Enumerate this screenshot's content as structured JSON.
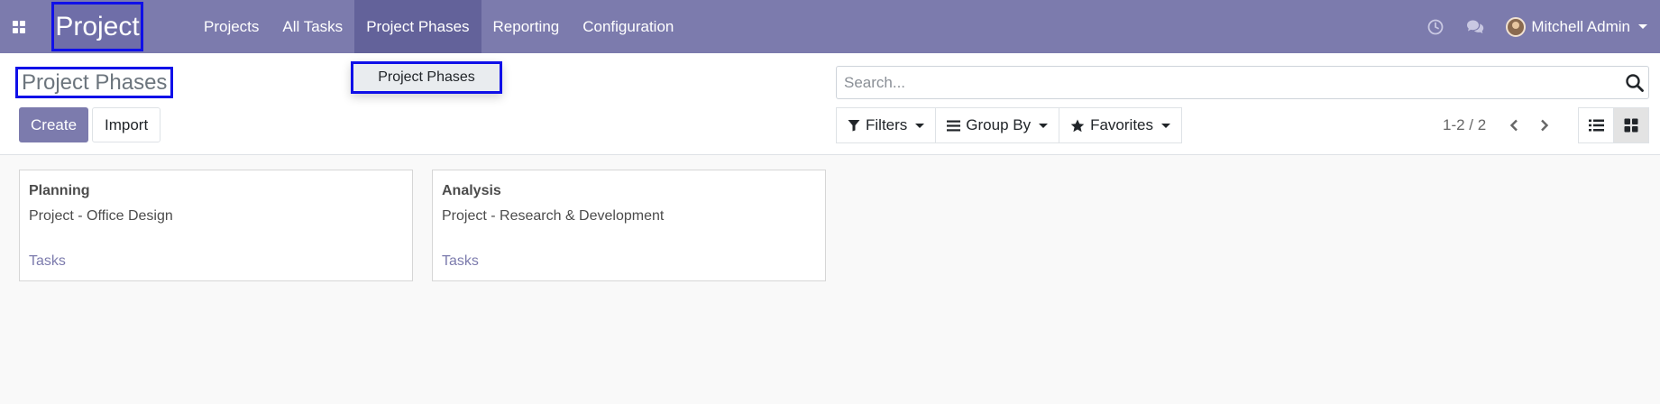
{
  "navbar": {
    "app_title": "Project",
    "menu": [
      "Projects",
      "All Tasks",
      "Project Phases",
      "Reporting",
      "Configuration"
    ],
    "user_name": "Mitchell Admin",
    "bg_color": "#7c7bad"
  },
  "dropdown": {
    "items": [
      "Project Phases"
    ]
  },
  "control_panel": {
    "title": "Project Phases",
    "create_label": "Create",
    "import_label": "Import",
    "search_placeholder": "Search...",
    "filters_label": "Filters",
    "groupby_label": "Group By",
    "favorites_label": "Favorites",
    "pager_value": "1-2 / 2"
  },
  "kanban": {
    "cards": [
      {
        "title": "Planning",
        "project": "Project - Office Design",
        "link": "Tasks"
      },
      {
        "title": "Analysis",
        "project": "Project - Research & Development",
        "link": "Tasks"
      }
    ]
  },
  "icons": {
    "apps": "grid-icon",
    "activity": "clock-icon",
    "messaging": "chat-icon",
    "search": "search-icon",
    "filters": "filter-icon",
    "groupby": "bars-icon",
    "favorites": "star-icon",
    "prev": "chevron-left-icon",
    "next": "chevron-right-icon",
    "list_view": "list-icon",
    "kanban_view": "kanban-icon"
  }
}
